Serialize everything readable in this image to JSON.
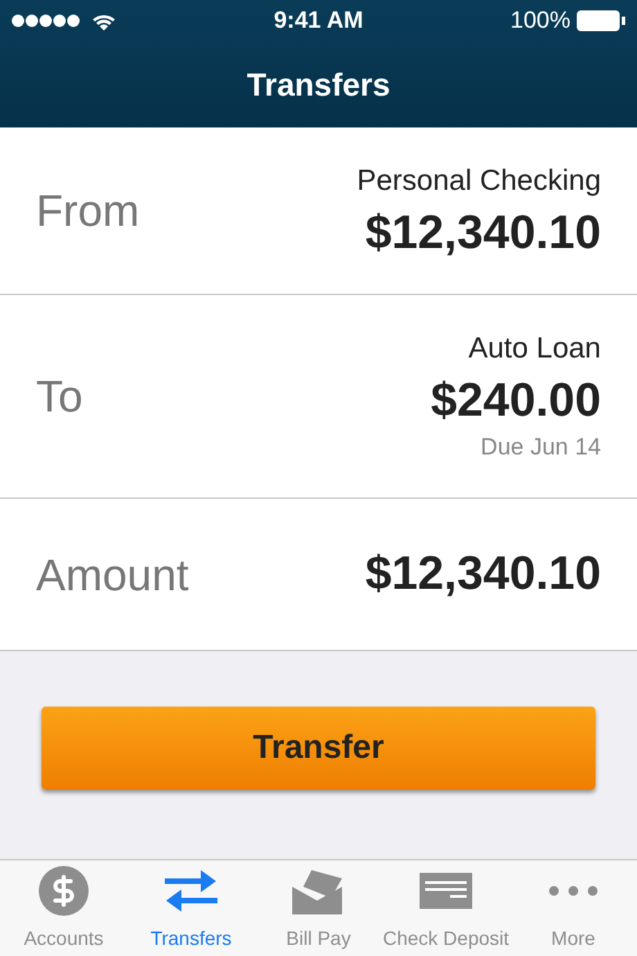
{
  "status_bar": {
    "time": "9:41 AM",
    "battery": "100%"
  },
  "nav": {
    "title": "Transfers"
  },
  "rows": [
    {
      "label": "From",
      "title": "Personal Checking",
      "amount": "$12,340.10"
    },
    {
      "label": "To",
      "title": "Auto Loan",
      "amount": "$240.00",
      "note": "Due Jun 14"
    },
    {
      "label": "Amount",
      "amount": "$12,340.10"
    }
  ],
  "button": "Transfer",
  "tabs": [
    {
      "kind": "accounts",
      "label": "Accounts",
      "selected": false
    },
    {
      "kind": "transfers",
      "label": "Transfers",
      "selected": true
    },
    {
      "kind": "billpay",
      "label": "Bill Pay",
      "selected": false
    },
    {
      "kind": "deposit",
      "label": "Check Deposit",
      "selected": false
    },
    {
      "kind": "more",
      "label": "More",
      "selected": false
    }
  ]
}
